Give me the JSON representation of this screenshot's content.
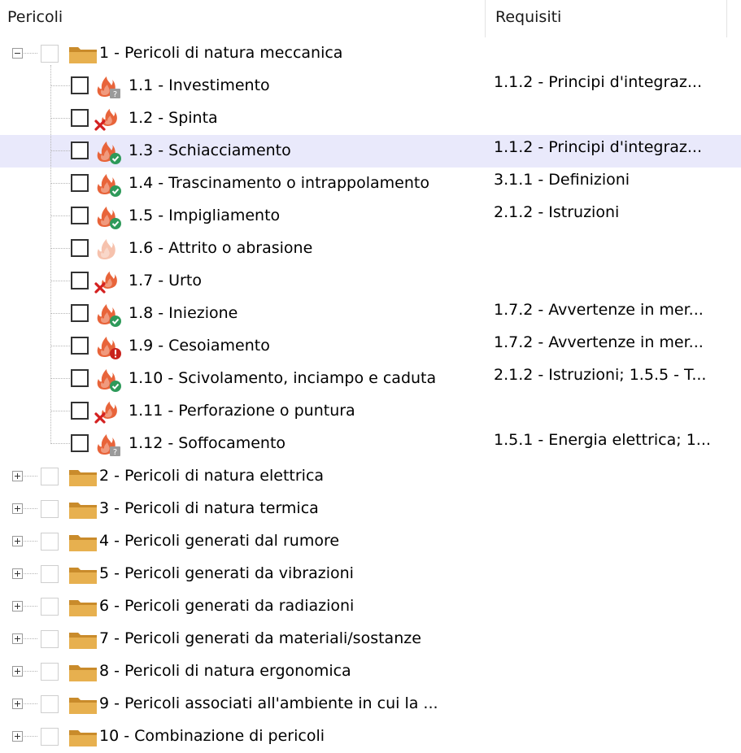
{
  "columns": {
    "pericoli": "Pericoli",
    "requisiti": "Requisiti"
  },
  "groups": [
    {
      "label": "1 - Pericoli di natura meccanica",
      "expanded": true
    },
    {
      "label": "2 - Pericoli di natura elettrica",
      "expanded": false
    },
    {
      "label": "3 - Pericoli di natura termica",
      "expanded": false
    },
    {
      "label": "4 - Pericoli generati dal rumore",
      "expanded": false
    },
    {
      "label": "5 - Pericoli generati da vibrazioni",
      "expanded": false
    },
    {
      "label": "6 - Pericoli generati da radiazioni",
      "expanded": false
    },
    {
      "label": "7 - Pericoli generati da materiali/sostanze",
      "expanded": false
    },
    {
      "label": "8 - Pericoli di natura ergonomica",
      "expanded": false
    },
    {
      "label": "9 - Pericoli associati all'ambiente in cui la ...",
      "expanded": false
    },
    {
      "label": "10 - Combinazione di pericoli",
      "expanded": false
    }
  ],
  "items": [
    {
      "label": "1.1 - Investimento",
      "status": "unknown",
      "req": "1.1.2 - Principi d'integraz..."
    },
    {
      "label": "1.2 - Spinta",
      "status": "excluded",
      "req": ""
    },
    {
      "label": "1.3 - Schiacciamento",
      "status": "ok",
      "req": "1.1.2 - Principi d'integraz...",
      "selected": true
    },
    {
      "label": "1.4 - Trascinamento o intrappolamento",
      "status": "ok",
      "req": "3.1.1 - Definizioni"
    },
    {
      "label": "1.5 - Impigliamento",
      "status": "ok",
      "req": "2.1.2 - Istruzioni"
    },
    {
      "label": "1.6 - Attrito o abrasione",
      "status": "none",
      "req": ""
    },
    {
      "label": "1.7 - Urto",
      "status": "excluded",
      "req": ""
    },
    {
      "label": "1.8 - Iniezione",
      "status": "ok",
      "req": "1.7.2 - Avvertenze in mer..."
    },
    {
      "label": "1.9 - Cesoiamento",
      "status": "warning",
      "req": "1.7.2 - Avvertenze in mer..."
    },
    {
      "label": "1.10 - Scivolamento, inciampo e caduta",
      "status": "ok",
      "req": "2.1.2 - Istruzioni; 1.5.5 - T..."
    },
    {
      "label": "1.11 - Perforazione o puntura",
      "status": "excluded",
      "req": ""
    },
    {
      "label": "1.12 - Soffocamento",
      "status": "unknown",
      "req": "1.5.1 - Energia elettrica; 1..."
    }
  ],
  "icons": {
    "flame": "#e8643a",
    "flame_faded": "#f6c2ad",
    "status_ok": "#2e9a5a",
    "status_excluded": "#d42020",
    "status_warning": "#c9221d",
    "status_unknown": "#9a9a9a",
    "folder": "#e7b04f"
  }
}
